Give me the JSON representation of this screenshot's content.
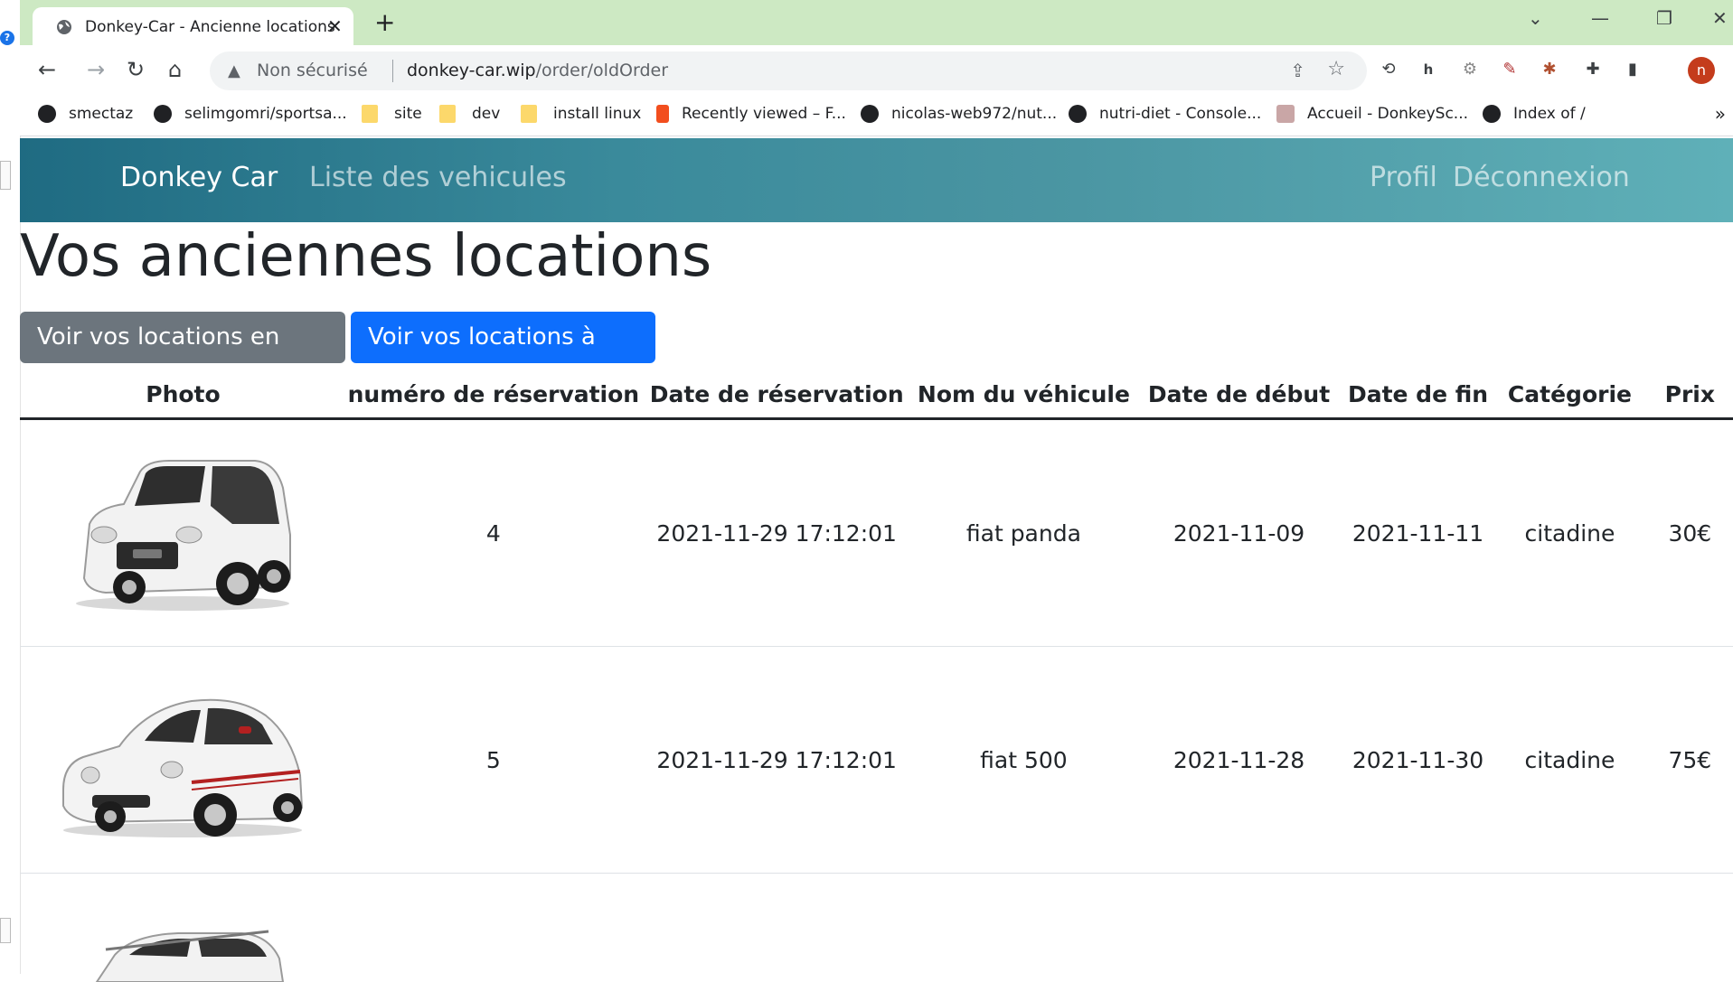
{
  "browser": {
    "tab_title": "Donkey-Car - Ancienne locations",
    "new_tab_symbol": "+",
    "security_label": "Non sécurisé",
    "url_host": "donkey-car.wip",
    "url_path": "/order/oldOrder",
    "profile_initial": "n",
    "bookmarks": [
      {
        "label": "smectaz",
        "icon": "github-icon"
      },
      {
        "label": "selimgomri/sportsa...",
        "icon": "globe-icon"
      },
      {
        "label": "site",
        "icon": "folder-icon"
      },
      {
        "label": "dev",
        "icon": "folder-icon"
      },
      {
        "label": "install linux",
        "icon": "folder-icon"
      },
      {
        "label": "Recently viewed – F...",
        "icon": "figma-icon"
      },
      {
        "label": "nicolas-web972/nut...",
        "icon": "globe-icon"
      },
      {
        "label": "nutri-diet - Console...",
        "icon": "globe-icon"
      },
      {
        "label": "Accueil - DonkeySc...",
        "icon": "donkey-icon"
      },
      {
        "label": "Index of /",
        "icon": "globe-icon"
      }
    ]
  },
  "navbar": {
    "brand": "Donkey Car",
    "vehicles_link": "Liste des vehicules",
    "profile_link": "Profil",
    "logout_link": "Déconnexion",
    "gradient_start": "#1f6b82",
    "gradient_end": "#5fb0b8"
  },
  "page": {
    "title": "Vos anciennes locations",
    "btn_current": "Voir vos locations en cours",
    "btn_upcoming": "Voir vos locations à venir"
  },
  "table": {
    "headers": {
      "photo": "Photo",
      "booking_number": "numéro de réservation",
      "booking_date": "Date de réservation",
      "vehicle_name": "Nom du véhicule",
      "start_date": "Date de début",
      "end_date": "Date de fin",
      "category": "Catégorie",
      "price": "Prix"
    },
    "rows": [
      {
        "photo": "white-fiat-panda-image",
        "number": "4",
        "booking_date": "2021-11-29 17:12:01",
        "vehicle": "fiat panda",
        "start": "2021-11-09",
        "end": "2021-11-11",
        "category": "citadine",
        "price": "30€"
      },
      {
        "photo": "white-fiat-500-image",
        "number": "5",
        "booking_date": "2021-11-29 17:12:01",
        "vehicle": "fiat 500",
        "start": "2021-11-28",
        "end": "2021-11-30",
        "category": "citadine",
        "price": "75€"
      }
    ]
  },
  "colors": {
    "btn_grey": "#6c757d",
    "btn_blue": "#0d6efd",
    "tab_strip": "#cde9c3"
  }
}
